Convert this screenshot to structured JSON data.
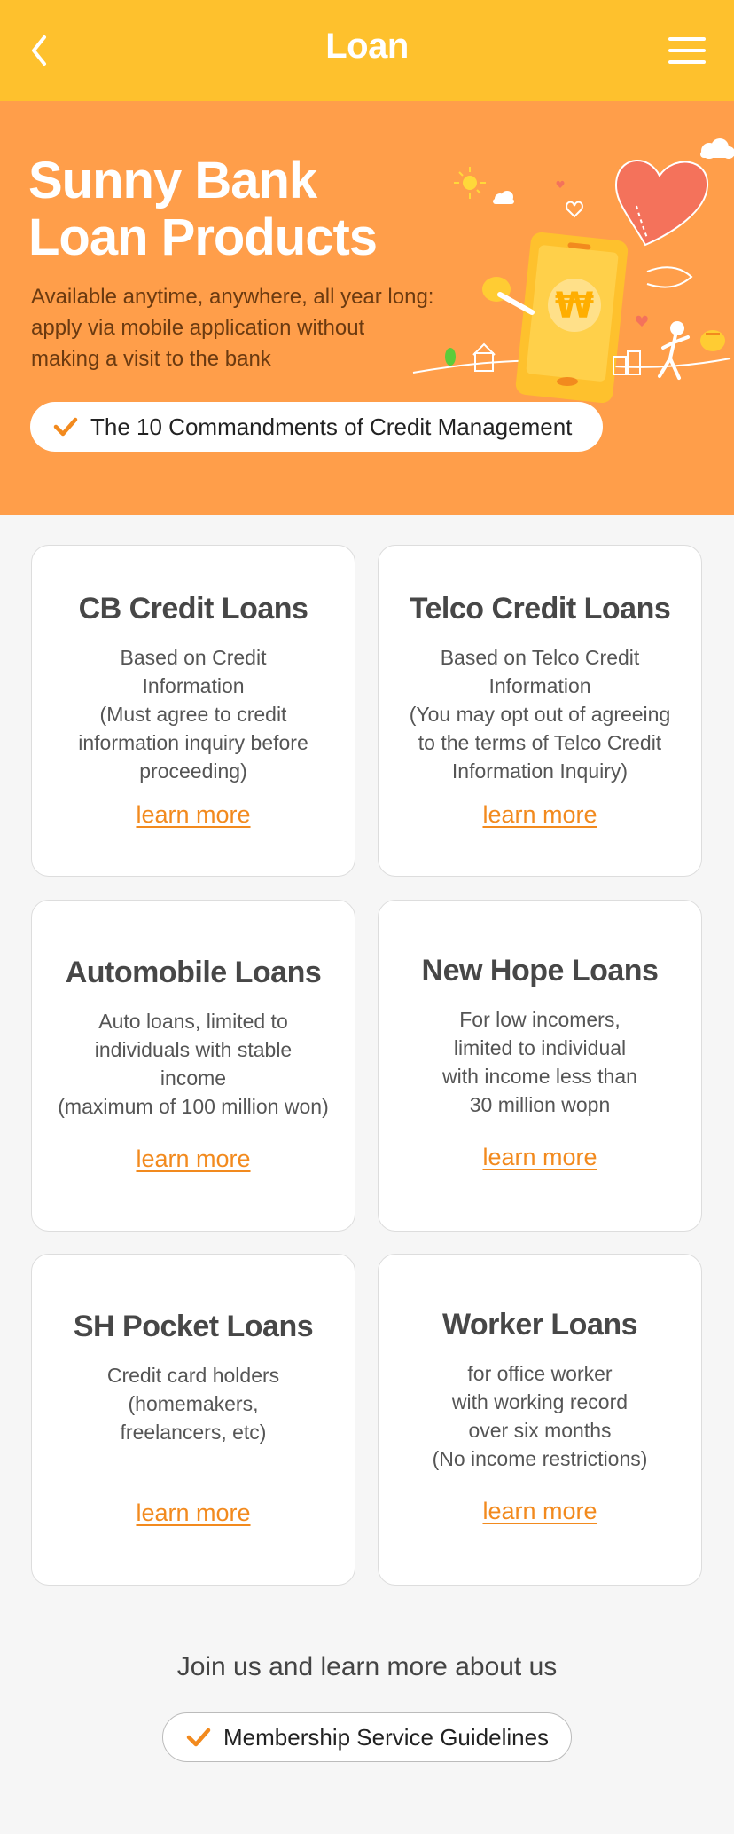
{
  "header": {
    "title": "Loan"
  },
  "hero": {
    "title_line1": "Sunny Bank",
    "title_line2": "Loan Products",
    "desc_line1": "Available anytime, anywhere, all year long:",
    "desc_line2": "apply via mobile application without",
    "desc_line3": "making a visit to the bank",
    "button_label": "The 10 Commandments of Credit Management",
    "coin_symbol": "₩"
  },
  "products": [
    {
      "title": "CB Credit Loans",
      "desc": [
        "Based on Credit",
        "Information",
        "(Must agree to credit",
        "information inquiry before",
        "proceeding)"
      ],
      "link": "learn more"
    },
    {
      "title": "Telco Credit Loans",
      "desc": [
        "Based on Telco Credit",
        "Information",
        "(You may opt out of agreeing",
        "to the terms of Telco Credit",
        "Information Inquiry)"
      ],
      "link": "learn more"
    },
    {
      "title": "Automobile Loans",
      "desc": [
        "Auto loans, limited to",
        "individuals with stable",
        "income",
        "(maximum of 100 million won)"
      ],
      "link": "learn more"
    },
    {
      "title": "New Hope Loans",
      "desc": [
        "For low incomers,",
        "limited to individual",
        "with income less than",
        "30 million wopn"
      ],
      "link": "learn more"
    },
    {
      "title": "SH Pocket Loans",
      "desc": [
        "Credit card holders",
        "(homemakers,",
        "freelancers, etc)"
      ],
      "link": "learn more"
    },
    {
      "title": "Worker Loans",
      "desc": [
        "for office worker",
        "with working record",
        "over six months",
        "(No income restrictions)"
      ],
      "link": "learn more"
    }
  ],
  "footer": {
    "join_text": "Join us and learn more about us",
    "button_label": "Membership Service Guidelines"
  },
  "colors": {
    "header": "#fec12d",
    "hero": "#ff9e4a",
    "accent": "#f28a1e",
    "background": "#f6f6f6"
  },
  "icons": {
    "back": "chevron-left-icon",
    "menu": "hamburger-menu-icon",
    "check": "checkmark-icon"
  }
}
